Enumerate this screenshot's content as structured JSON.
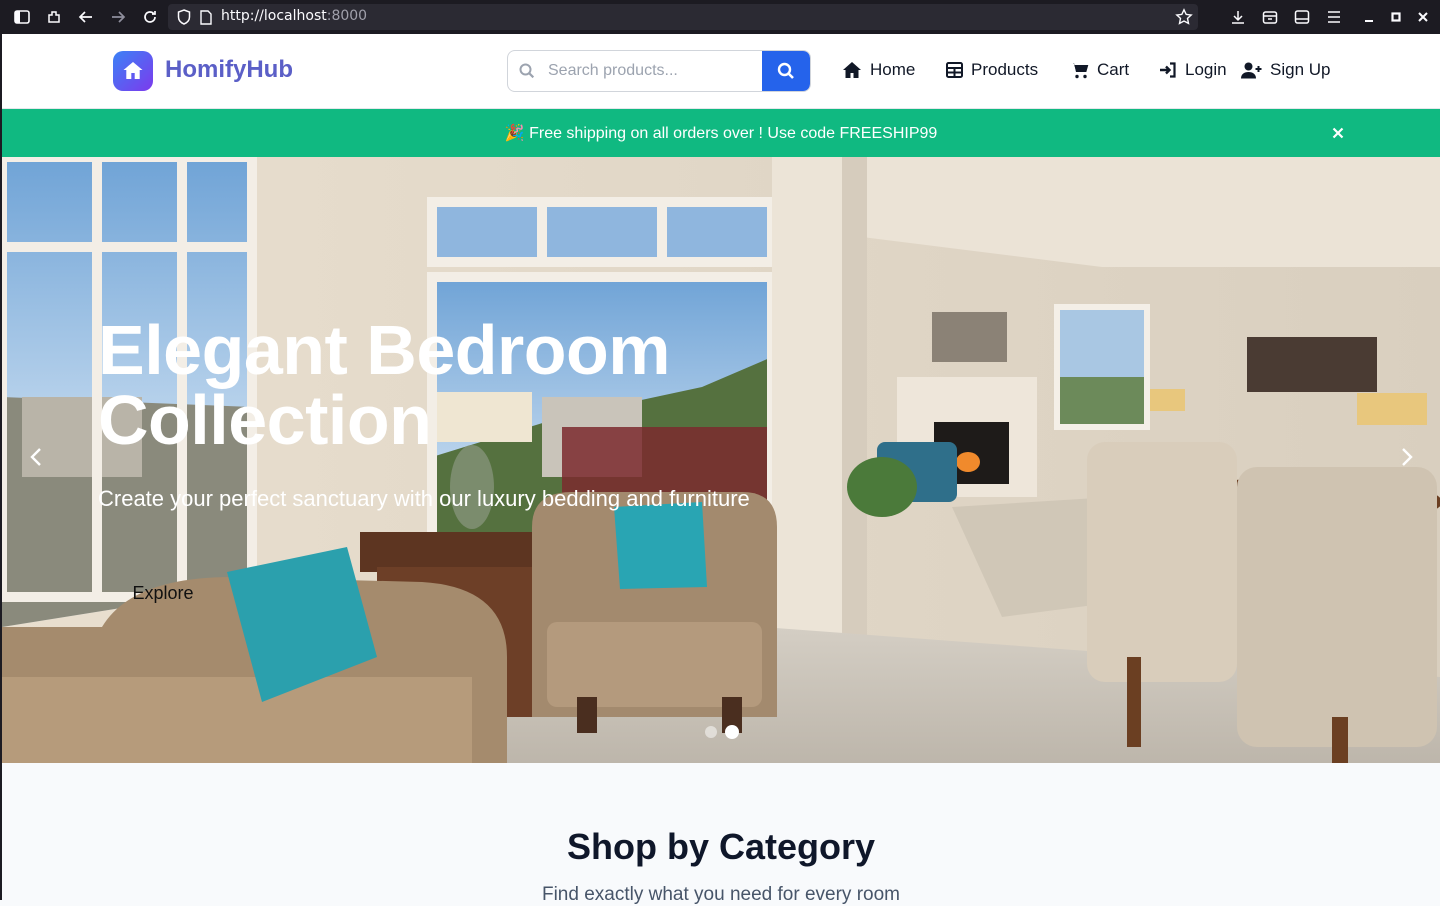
{
  "browser": {
    "url_host": "http://localhost",
    "url_port": ":8000"
  },
  "header": {
    "brand": "HomifyHub",
    "search_placeholder": "Search products...",
    "nav": {
      "home": "Home",
      "products": "Products",
      "cart": "Cart",
      "login": "Login",
      "signup": "Sign Up"
    }
  },
  "promo": {
    "text": "🎉 Free shipping on all orders over ! Use code FREESHIP99"
  },
  "hero": {
    "title": "Elegant Bedroom Collection",
    "subtitle": "Create your perfect sanctuary with our luxury bedding and furniture",
    "button": "Explore",
    "slides_total": 2,
    "active_slide": 2
  },
  "categories": {
    "title": "Shop by Category",
    "subtitle": "Find exactly what you need for every room"
  },
  "colors": {
    "brand": "#5b5fc7",
    "search_button": "#2563eb",
    "promo_bg": "#10b981"
  },
  "icons": [
    "sidebar-icon",
    "extensions-icon",
    "back-icon",
    "forward-icon",
    "reload-icon",
    "shield-icon",
    "page-icon",
    "star-icon",
    "download-icon",
    "container-icon",
    "reader-icon",
    "menu-icon",
    "minimize-icon",
    "maximize-icon",
    "close-icon",
    "home-logo-icon",
    "search-icon",
    "home-icon",
    "grid-icon",
    "cart-icon",
    "login-icon",
    "user-plus-icon",
    "chevron-left-icon",
    "chevron-right-icon"
  ]
}
